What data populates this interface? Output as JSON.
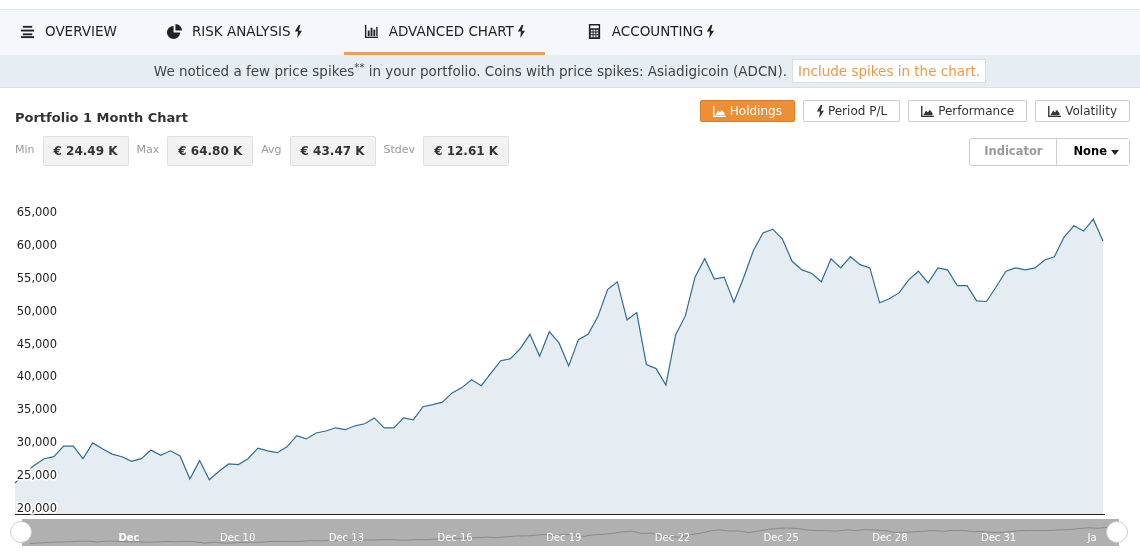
{
  "tabs": [
    {
      "label": "OVERVIEW",
      "selected": false
    },
    {
      "label": "RISK ANALYSIS",
      "selected": false
    },
    {
      "label": "ADVANCED CHART",
      "selected": true
    },
    {
      "label": "ACCOUNTING",
      "selected": false
    }
  ],
  "notice": {
    "text": "We noticed a few price spikes$^{**}$ in your portfolio. Coins with price spikes: Asiadigicoin (ADCN).",
    "link": "Include spikes in the chart."
  },
  "title": "Portfolio 1 Month Chart",
  "modes": [
    {
      "label": "Holdings",
      "selected": true
    },
    {
      "label": "Period P/L",
      "selected": false
    },
    {
      "label": "Performance",
      "selected": false
    },
    {
      "label": "Volatility",
      "selected": false
    }
  ],
  "stats": [
    {
      "label": "Min",
      "value": "€ 24.49 K"
    },
    {
      "label": "Max",
      "value": "€ 64.80 K"
    },
    {
      "label": "Avg",
      "value": "€ 43.47 K"
    },
    {
      "label": "Stdev",
      "value": "€ 12.61 K"
    }
  ],
  "indicator": {
    "label": "Indicator",
    "value": "None"
  },
  "chart_data": {
    "type": "area",
    "ylim": [
      20000,
      65000
    ],
    "yticks": [
      {
        "value": 20000,
        "label": "20,000"
      },
      {
        "value": 25000,
        "label": "25,000"
      },
      {
        "value": 30000,
        "label": "30,000"
      },
      {
        "value": 35000,
        "label": "35,000"
      },
      {
        "value": 40000,
        "label": "40,000"
      },
      {
        "value": 45000,
        "label": "45,000"
      },
      {
        "value": 50000,
        "label": "50,000"
      },
      {
        "value": 55000,
        "label": "55,000"
      },
      {
        "value": 60000,
        "label": "60,000"
      },
      {
        "value": 65000,
        "label": "65,000"
      }
    ],
    "series": [
      {
        "color": "#2f6d92",
        "values": [
          23800,
          25300,
          26500,
          27500,
          27800,
          29400,
          29400,
          27500,
          29900,
          29000,
          28200,
          27800,
          27100,
          27500,
          28800,
          28000,
          28700,
          27900,
          24400,
          27200,
          24300,
          25600,
          26700,
          26600,
          27500,
          29100,
          28700,
          28400,
          29300,
          31000,
          30500,
          31400,
          31700,
          32200,
          31900,
          32500,
          32800,
          33700,
          32200,
          32200,
          33700,
          33400,
          35400,
          35700,
          36100,
          37500,
          38300,
          39500,
          38600,
          40500,
          42400,
          42700,
          44200,
          46400,
          43100,
          46800,
          45100,
          41600,
          45600,
          46400,
          49100,
          53200,
          54400,
          48600,
          49700,
          41800,
          41200,
          38700,
          46300,
          49200,
          55100,
          57900,
          54800,
          55100,
          51300,
          55000,
          59100,
          61800,
          62400,
          60900,
          57500,
          56200,
          55700,
          54400,
          57900,
          56500,
          58200,
          57000,
          56500,
          51200,
          51800,
          52700,
          54700,
          56000,
          54200,
          56500,
          56200,
          53800,
          53800,
          51500,
          51400,
          53600,
          56000,
          56500,
          56200,
          56500,
          57700,
          58200,
          61200,
          62900,
          62100,
          63900,
          60600
        ]
      }
    ]
  },
  "navigator": {
    "labels": [
      "Dec",
      "Dec 10",
      "Dec 13",
      "Dec 16",
      "Dec 19",
      "Dec 22",
      "Dec 25",
      "Dec 28",
      "Dec 31",
      "Ja"
    ]
  }
}
